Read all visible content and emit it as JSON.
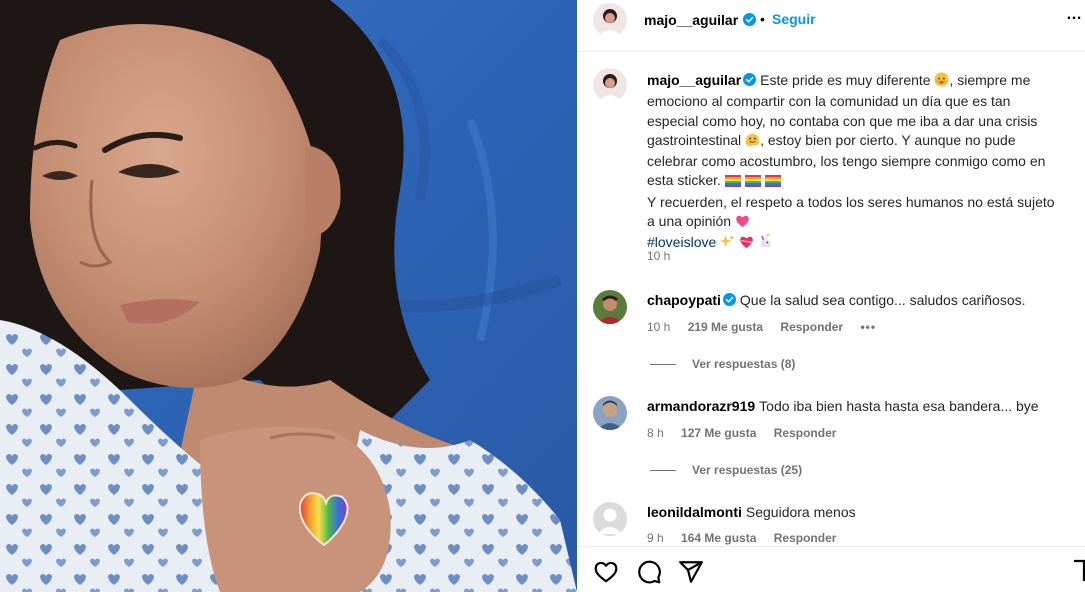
{
  "post": {
    "author": "majo__aguilar",
    "follow_label": "Seguir",
    "separator": "•",
    "more_label": "…"
  },
  "caption": {
    "author": "majo__aguilar",
    "line1": "Este pride es muy diferente",
    "line1b": ", siempre me",
    "line2": "emociono al compartir con la comunidad un día que es tan",
    "line3": "especial como hoy, no contaba con que me iba a dar una crisis",
    "line4": "gastrointestinal",
    "line4b": ", estoy bien por cierto. Y aunque no pude",
    "line5": "celebrar como acostumbro, los tengo siempre conmigo como en",
    "line6": "esta sticker.",
    "line7": "Y recuerden, el respeto a todos los seres humanos no está sujeto",
    "line8": "a una opinión",
    "hashtag": "#loveislove",
    "time": "10 h"
  },
  "comments": [
    {
      "user": "chapoypati",
      "verified": true,
      "text": "Que la salud sea contigo... saludos cariñosos.",
      "time": "10 h",
      "likes": "219 Me gusta",
      "reply": "Responder",
      "more": "•••",
      "replies": "Ver respuestas (8)"
    },
    {
      "user": "armandorazr919",
      "verified": false,
      "text": "Todo iba bien hasta hasta esa bandera... bye",
      "time": "8 h",
      "likes": "127 Me gusta",
      "reply": "Responder",
      "replies": "Ver respuestas (25)"
    },
    {
      "user": "leonildalmonti",
      "verified": false,
      "text": "Seguidora menos",
      "time": "9 h",
      "likes": "164 Me gusta",
      "reply": "Responder"
    }
  ],
  "icons": {
    "verified": "verified-badge-icon",
    "like": "heart-icon",
    "comment": "comment-icon",
    "share": "paper-plane-icon",
    "save": "bookmark-icon"
  },
  "colors": {
    "accent": "#0095f6",
    "hashtag": "#00376b",
    "muted": "#737373",
    "sheet": "#2f66b8"
  }
}
